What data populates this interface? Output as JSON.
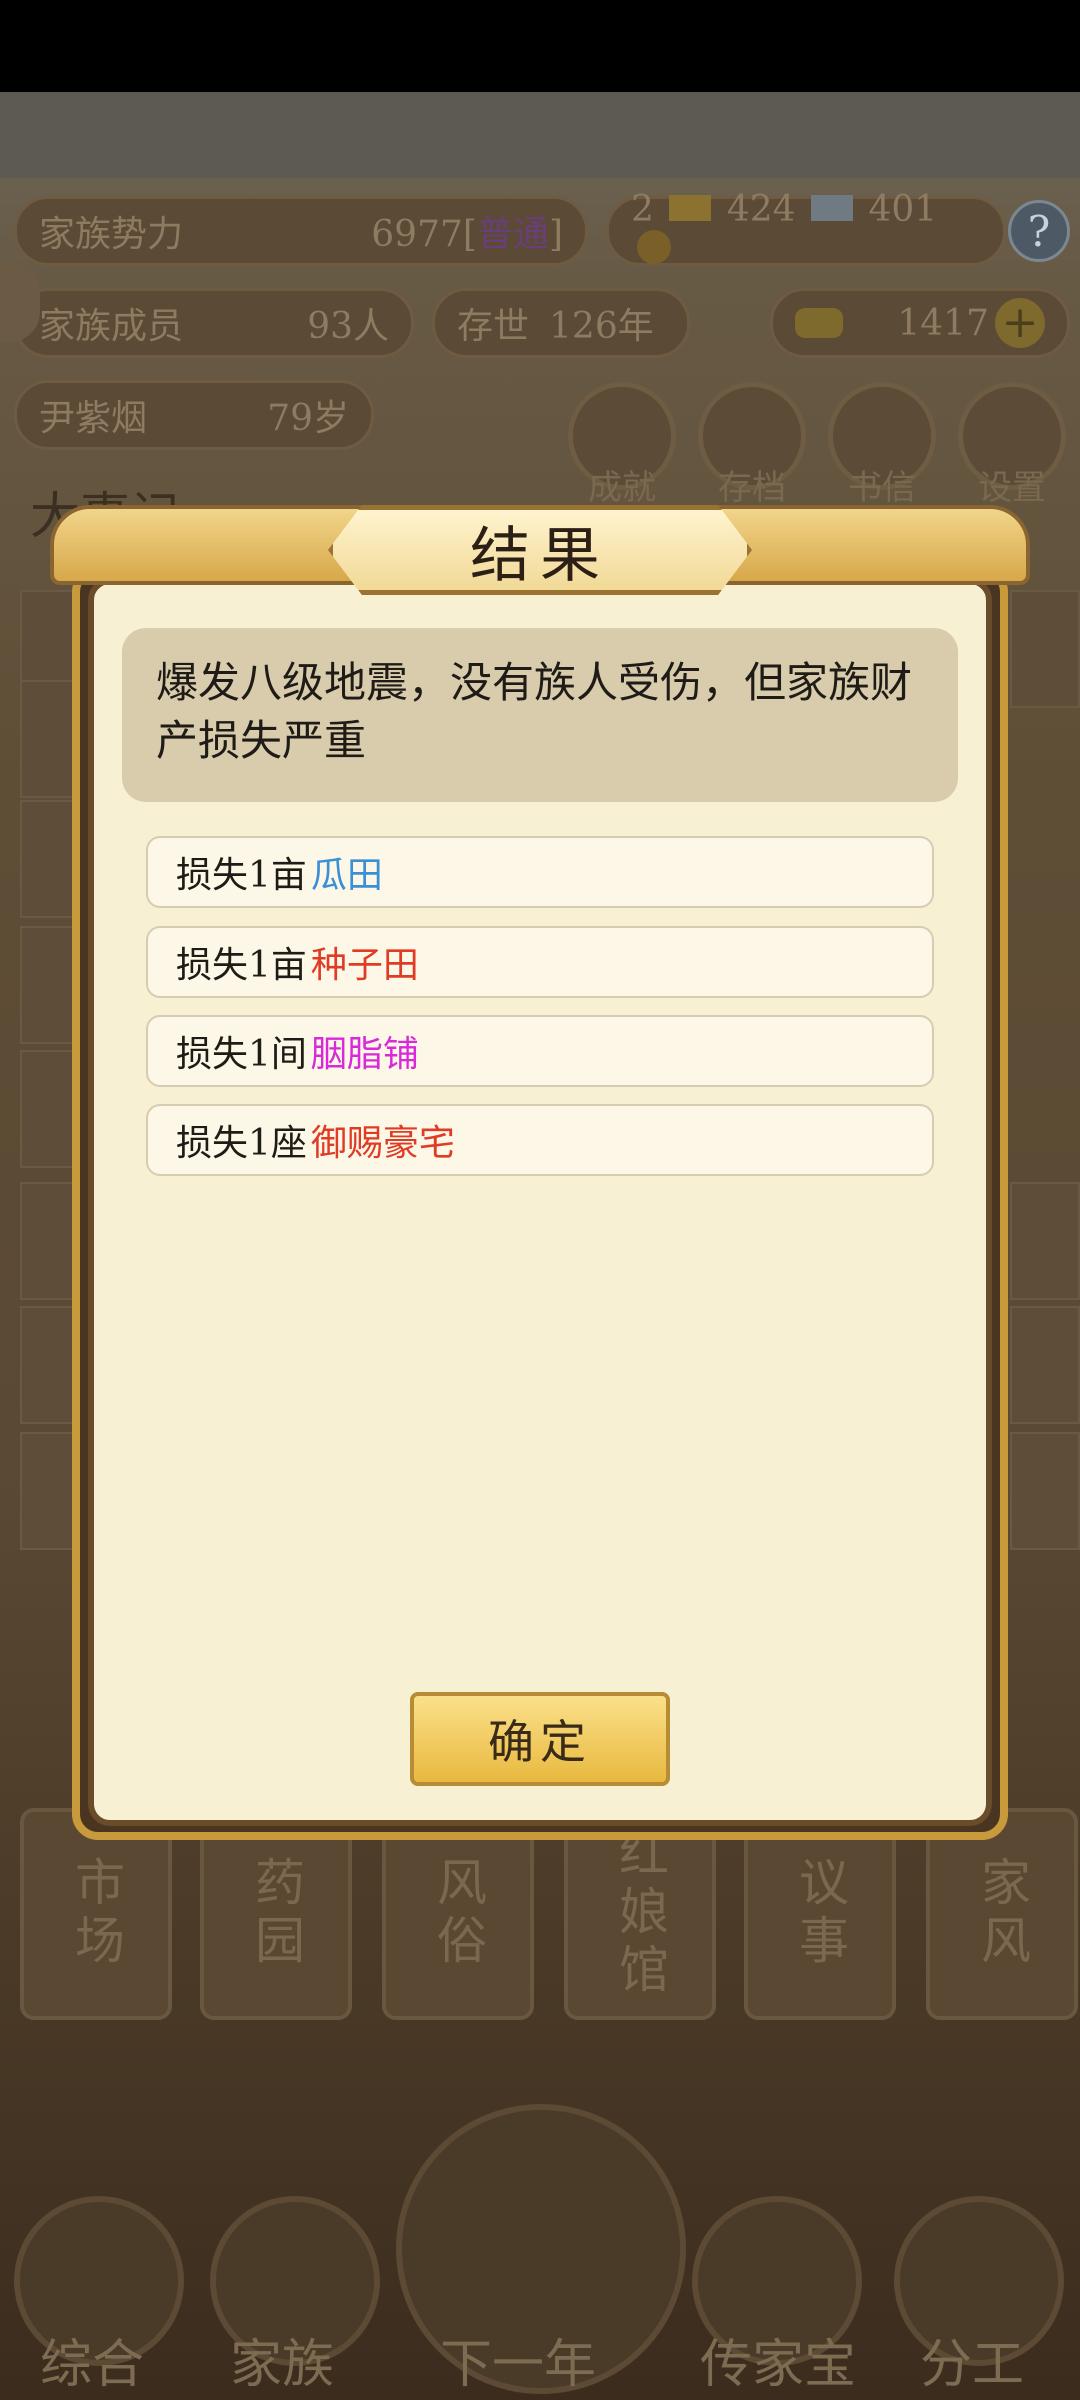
{
  "header": {
    "clan_power_label": "家族势力",
    "clan_power_value": "6977[",
    "clan_power_rank": "普通",
    "clan_power_suffix": "]",
    "members_label": "家族成员",
    "members_value": "93人",
    "existence_label": "存世",
    "existence_value": "126年",
    "resource_a": "2",
    "resource_gold": "424",
    "resource_silver": "401",
    "ingot_value": "1417",
    "leader_name": "尹紫烟",
    "leader_age": "79岁"
  },
  "top_buttons": [
    {
      "label": "成就"
    },
    {
      "label": "存档"
    },
    {
      "label": "书信"
    },
    {
      "label": "设置"
    }
  ],
  "chronicle_title": "大事记",
  "dialog": {
    "title": "结果",
    "message": "爆发八级地震，没有族人受伤，但家族财产损失严重",
    "losses": [
      {
        "prefix": "损失1亩",
        "item": "瓜田",
        "color": "#3a8fd6"
      },
      {
        "prefix": "损失1亩",
        "item": "种子田",
        "color": "#e03b24"
      },
      {
        "prefix": "损失1间",
        "item": "胭脂铺",
        "color": "#d92ad9"
      },
      {
        "prefix": "损失1座",
        "item": "御赐豪宅",
        "color": "#e03b24"
      }
    ],
    "confirm_label": "确定"
  },
  "buildings": [
    {
      "label": "市场"
    },
    {
      "label": "药园"
    },
    {
      "label": "风俗"
    },
    {
      "label": "红娘馆"
    },
    {
      "label": "议事"
    },
    {
      "label": "家风"
    }
  ],
  "nav": [
    {
      "label": "综合"
    },
    {
      "label": "家族"
    },
    {
      "label": "下一年"
    },
    {
      "label": "传家宝"
    },
    {
      "label": "分工"
    }
  ]
}
